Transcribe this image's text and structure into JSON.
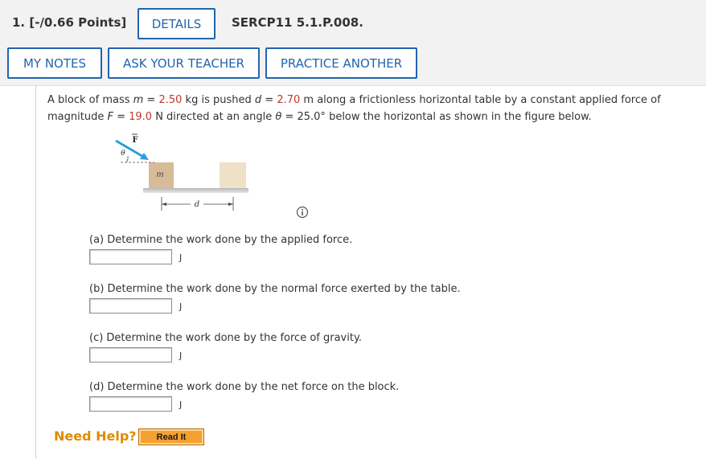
{
  "header": {
    "points": "1.  [-/0.66 Points]",
    "details_label": "DETAILS",
    "code": "SERCP11 5.1.P.008.",
    "my_notes_label": "MY NOTES",
    "ask_teacher_label": "ASK YOUR TEACHER",
    "practice_label": "PRACTICE ANOTHER"
  },
  "problem": {
    "t1": "A block of mass ",
    "m_var": "m",
    "eq1": " = ",
    "mass": "2.50",
    "t2": " kg is pushed ",
    "d_var": "d",
    "eq2": " = ",
    "distance": "2.70",
    "t3": " m along a frictionless horizontal table by a constant applied force of magnitude ",
    "f_var": "F",
    "eq3": " = ",
    "force": "19.0",
    "t4": " N directed at an angle ",
    "theta": "θ",
    "eq4": " = ",
    "angle": "25.0°",
    "t5": " below the horizontal as shown in the figure below."
  },
  "figure": {
    "force_label": "F",
    "theta_label": "θ",
    "mass_label": "m",
    "d_label": "d"
  },
  "questions": [
    {
      "text": "(a) Determine the work done by the applied force.",
      "unit": "J",
      "value": ""
    },
    {
      "text": "(b) Determine the work done by the normal force exerted by the table.",
      "unit": "J",
      "value": ""
    },
    {
      "text": "(c) Determine the work done by the force of gravity.",
      "unit": "J",
      "value": ""
    },
    {
      "text": "(d) Determine the work done by the net force on the block.",
      "unit": "J",
      "value": ""
    }
  ],
  "help": {
    "need_help": "Need Help?",
    "read_it": "Read It"
  },
  "colors": {
    "accent": "#2264ae",
    "highlight": "#c0392b",
    "help": "#e08a00",
    "arrow": "#2a9fd8"
  },
  "icons": [
    "info-icon",
    "force-arrow-icon"
  ]
}
